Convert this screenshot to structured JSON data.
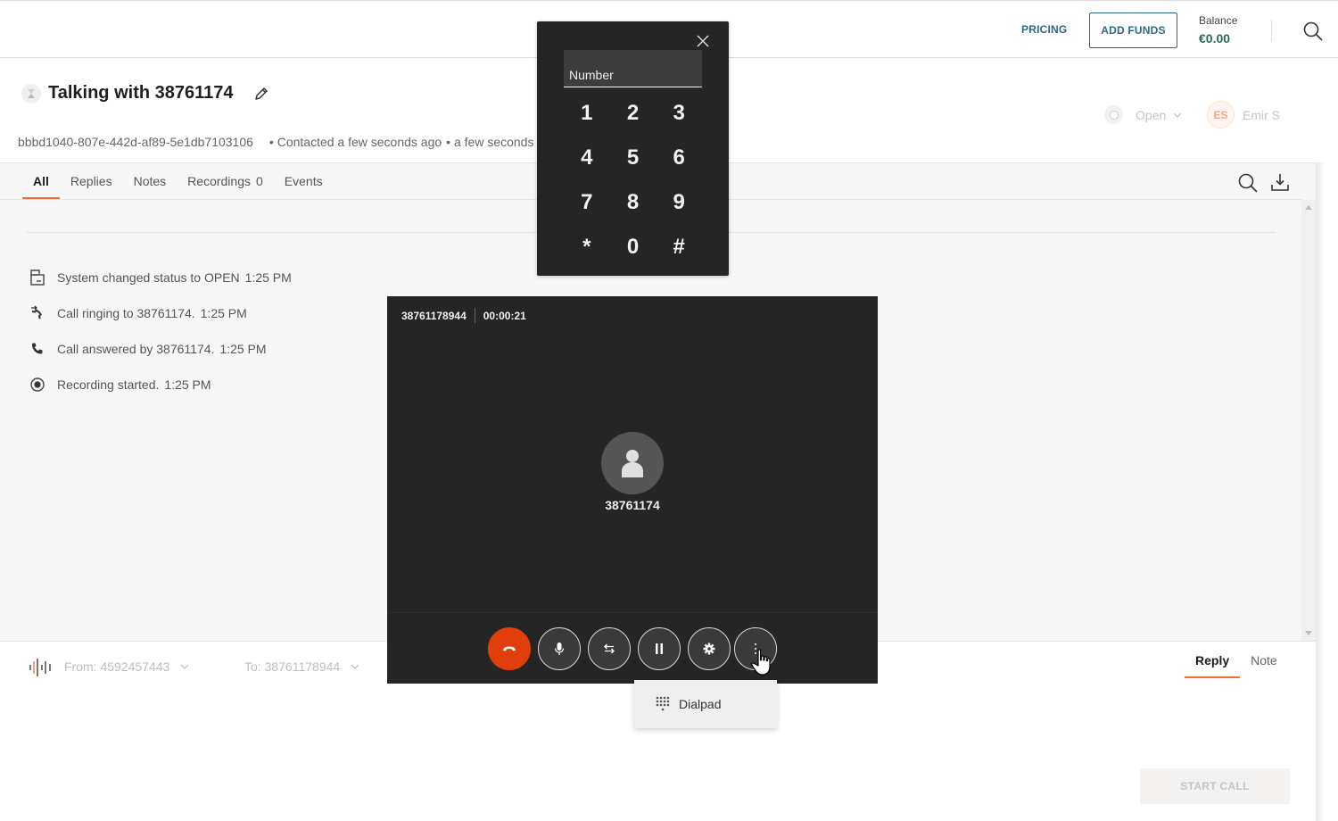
{
  "topbar": {
    "pricing_label": "PRICING",
    "add_funds_label": "ADD FUNDS",
    "balance_label": "Balance",
    "balance_value": "€0.00"
  },
  "conversation": {
    "title": "Talking with 38761174",
    "id": "bbbd1040-807e-442d-af89-5e1db7103106",
    "meta_contacted": "• Contacted a few seconds ago",
    "meta_extra": "• a few seconds ago",
    "status": "Open",
    "assignee_initials": "ES",
    "assignee_name": "Emir S"
  },
  "tabs": [
    {
      "label": "All",
      "active": true
    },
    {
      "label": "Replies"
    },
    {
      "label": "Notes"
    },
    {
      "label": "Recordings",
      "count": "0"
    },
    {
      "label": "Events"
    }
  ],
  "events": [
    {
      "icon": "status-change-icon",
      "text": "System changed status to OPEN",
      "time": "1:25 PM"
    },
    {
      "icon": "call-outgoing-icon",
      "text": "Call ringing to 38761174.",
      "time": "1:25 PM"
    },
    {
      "icon": "phone-icon",
      "text": "Call answered by 38761174.",
      "time": "1:25 PM"
    },
    {
      "icon": "record-icon",
      "text": "Recording started.",
      "time": "1:25 PM"
    }
  ],
  "composer": {
    "from": "From: 4592457443",
    "to": "To: 38761178944",
    "reply_tabs": [
      {
        "label": "Reply",
        "active": true
      },
      {
        "label": "Note"
      }
    ],
    "start_call_label": "START CALL"
  },
  "call": {
    "number": "38761178944",
    "duration": "00:00:21",
    "callee": "38761174",
    "controls": [
      "hang-up",
      "mute",
      "transfer",
      "hold",
      "settings",
      "more"
    ],
    "more_menu": [
      {
        "icon": "dialpad-icon",
        "label": "Dialpad"
      }
    ]
  },
  "dialpad": {
    "placeholder": "Number",
    "keys": [
      "1",
      "2",
      "3",
      "4",
      "5",
      "6",
      "7",
      "8",
      "9",
      "*",
      "0",
      "#"
    ]
  }
}
